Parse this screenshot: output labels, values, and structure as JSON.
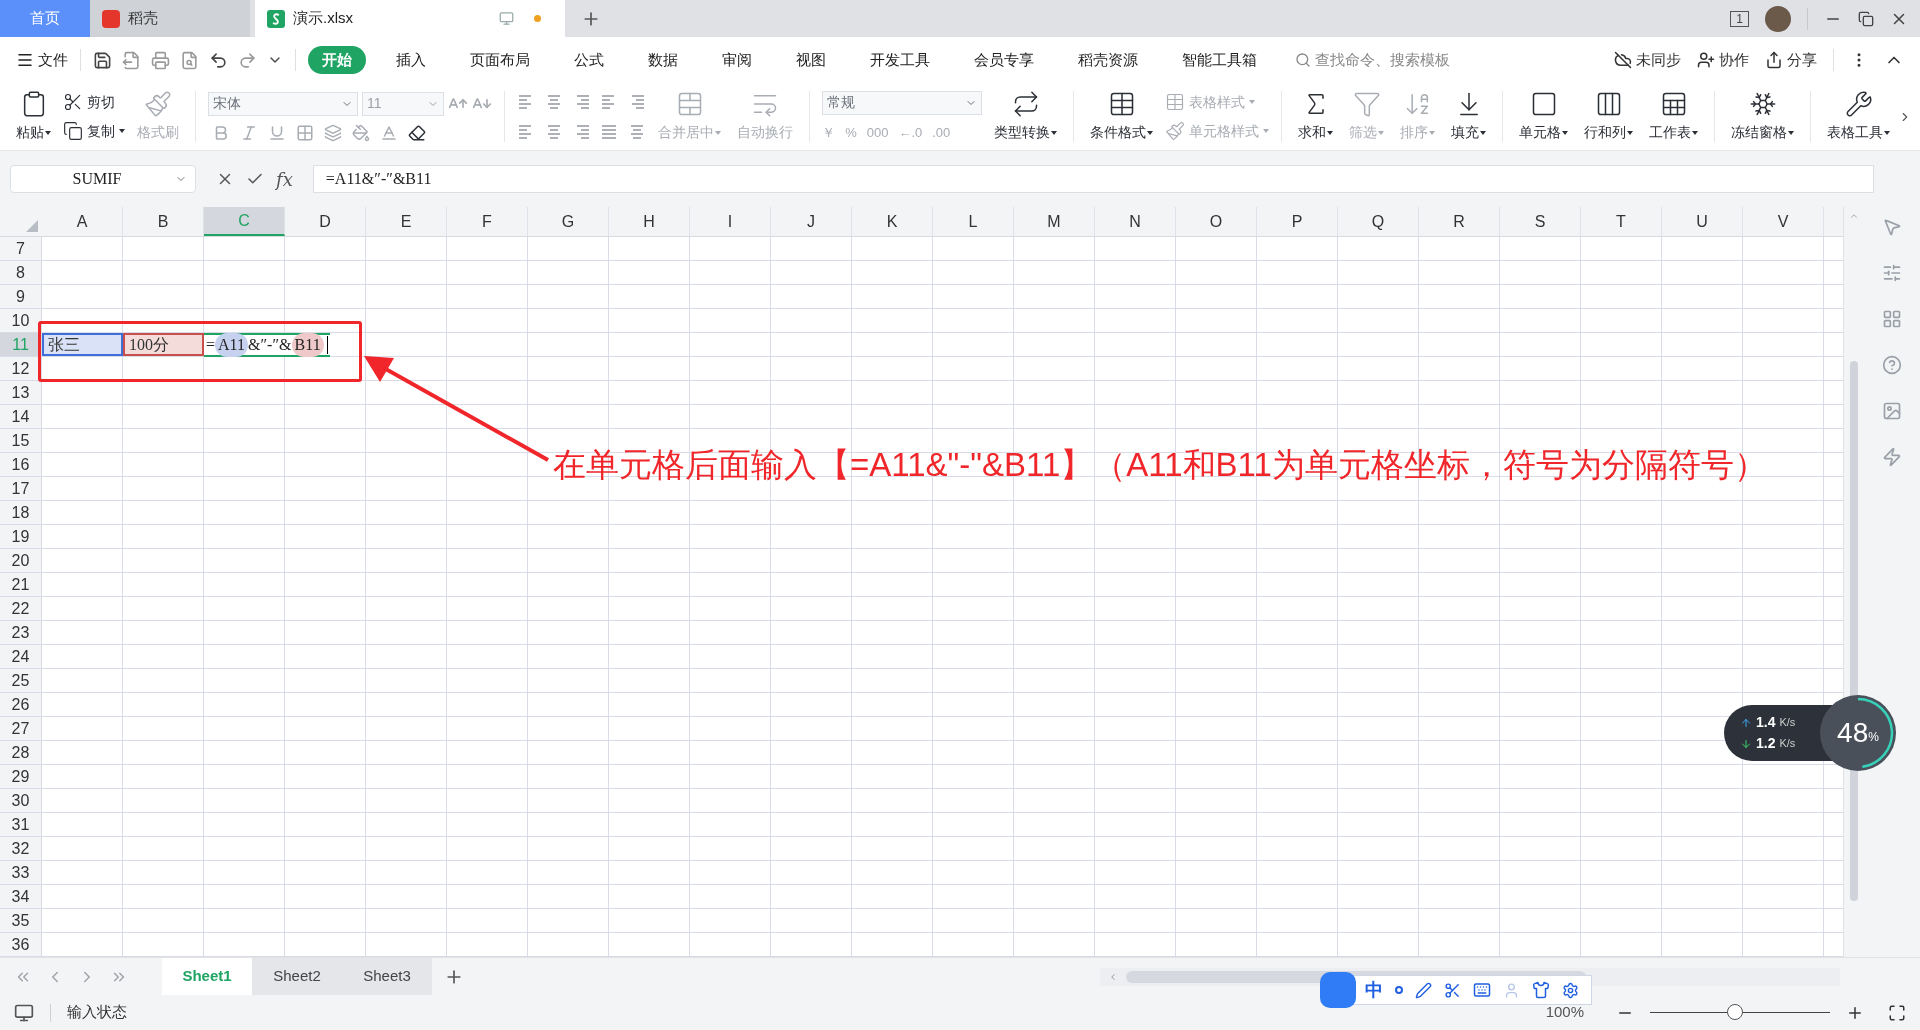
{
  "tabs": [
    {
      "label": "首页",
      "kind": "home",
      "selected": false
    },
    {
      "label": "稻壳",
      "kind": "docer",
      "selected": false
    },
    {
      "label": "演示.xlsx",
      "kind": "sheet",
      "selected": true
    }
  ],
  "window_count": "1",
  "menu": {
    "file": "文件",
    "items": [
      {
        "label": "开始",
        "selected": true
      },
      {
        "label": "插入",
        "selected": false
      },
      {
        "label": "页面布局",
        "selected": false
      },
      {
        "label": "公式",
        "selected": false
      },
      {
        "label": "数据",
        "selected": false
      },
      {
        "label": "审阅",
        "selected": false
      },
      {
        "label": "视图",
        "selected": false
      },
      {
        "label": "开发工具",
        "selected": false
      },
      {
        "label": "会员专享",
        "selected": false
      },
      {
        "label": "稻壳资源",
        "selected": false
      },
      {
        "label": "智能工具箱",
        "selected": false
      }
    ],
    "search": {
      "placeholder": "查找命令、搜索模板"
    },
    "actions": [
      "未同步",
      "协作",
      "分享"
    ]
  },
  "ribbon": [
    {
      "kind": "big",
      "label": "粘贴",
      "caret": true,
      "disabled": false
    },
    {
      "kind": "stack",
      "items": [
        {
          "label": "剪切",
          "caret": false,
          "disabled": false
        },
        {
          "label": "复制",
          "caret": true,
          "disabled": false
        }
      ]
    },
    {
      "kind": "big",
      "label": "格式刷",
      "caret": false,
      "disabled": true
    },
    {
      "kind": "sep"
    },
    {
      "kind": "font",
      "font": "宋体",
      "size": "11"
    },
    {
      "kind": "sep"
    },
    {
      "kind": "align"
    },
    {
      "kind": "big",
      "label": "合并居中",
      "caret": true,
      "disabled": true
    },
    {
      "kind": "big",
      "label": "自动换行",
      "caret": false,
      "disabled": true
    },
    {
      "kind": "sep"
    },
    {
      "kind": "number",
      "format": "常规",
      "buttons": [
        "￥",
        "%",
        "000",
        "←.0",
        ".00"
      ]
    },
    {
      "kind": "big",
      "label": "类型转换",
      "caret": true,
      "disabled": false
    },
    {
      "kind": "sep"
    },
    {
      "kind": "big",
      "label": "条件格式",
      "caret": true,
      "disabled": false
    },
    {
      "kind": "stack",
      "items": [
        {
          "label": "表格样式",
          "caret": true,
          "disabled": true
        },
        {
          "label": "单元格样式",
          "caret": true,
          "disabled": true
        }
      ]
    },
    {
      "kind": "sep"
    },
    {
      "kind": "big",
      "label": "求和",
      "caret": true,
      "disabled": false
    },
    {
      "kind": "big",
      "label": "筛选",
      "caret": true,
      "disabled": true
    },
    {
      "kind": "big",
      "label": "排序",
      "caret": true,
      "disabled": true
    },
    {
      "kind": "big",
      "label": "填充",
      "caret": true,
      "disabled": false
    },
    {
      "kind": "sep"
    },
    {
      "kind": "big",
      "label": "单元格",
      "caret": true,
      "disabled": false
    },
    {
      "kind": "big",
      "label": "行和列",
      "caret": true,
      "disabled": false
    },
    {
      "kind": "big",
      "label": "工作表",
      "caret": true,
      "disabled": false
    },
    {
      "kind": "sep"
    },
    {
      "kind": "big",
      "label": "冻结窗格",
      "caret": true,
      "disabled": false
    },
    {
      "kind": "sep"
    },
    {
      "kind": "big",
      "label": "表格工具",
      "caret": true,
      "disabled": false
    }
  ],
  "name_box": "SUMIF",
  "function_label": "fx",
  "formula": "=A11&″-″&B11",
  "columns": [
    {
      "label": "A",
      "selected": false
    },
    {
      "label": "B",
      "selected": false
    },
    {
      "label": "C",
      "selected": true
    },
    {
      "label": "D",
      "selected": false
    },
    {
      "label": "E",
      "selected": false
    },
    {
      "label": "F",
      "selected": false
    },
    {
      "label": "G",
      "selected": false
    },
    {
      "label": "H",
      "selected": false
    },
    {
      "label": "I",
      "selected": false
    },
    {
      "label": "J",
      "selected": false
    },
    {
      "label": "K",
      "selected": false
    },
    {
      "label": "L",
      "selected": false
    },
    {
      "label": "M",
      "selected": false
    },
    {
      "label": "N",
      "selected": false
    },
    {
      "label": "O",
      "selected": false
    },
    {
      "label": "P",
      "selected": false
    },
    {
      "label": "Q",
      "selected": false
    },
    {
      "label": "R",
      "selected": false
    },
    {
      "label": "S",
      "selected": false
    },
    {
      "label": "T",
      "selected": false
    },
    {
      "label": "U",
      "selected": false
    },
    {
      "label": "V",
      "selected": false
    }
  ],
  "rows": [
    {
      "label": "7",
      "selected": false
    },
    {
      "label": "8",
      "selected": false
    },
    {
      "label": "9",
      "selected": false
    },
    {
      "label": "10",
      "selected": false
    },
    {
      "label": "11",
      "selected": true,
      "cells": [
        {
          "kind": "ref",
          "text": "张三",
          "color": "#3f6fd8"
        },
        {
          "kind": "ref",
          "text": "100分",
          "color": "#c8504a"
        },
        {
          "kind": "editing",
          "parts": [
            {
              "kind": "plain",
              "text": "="
            },
            {
              "kind": "ref",
              "text": "A11",
              "color": "#c6d1ef"
            },
            {
              "kind": "plain",
              "text": "&″-″&"
            },
            {
              "kind": "ref",
              "text": "B11",
              "color": "#efc9c9"
            }
          ]
        }
      ]
    },
    {
      "label": "12",
      "selected": false
    },
    {
      "label": "13",
      "selected": false
    },
    {
      "label": "14",
      "selected": false
    },
    {
      "label": "15",
      "selected": false
    },
    {
      "label": "16",
      "selected": false
    },
    {
      "label": "17",
      "selected": false
    },
    {
      "label": "18",
      "selected": false
    },
    {
      "label": "19",
      "selected": false
    },
    {
      "label": "20",
      "selected": false
    },
    {
      "label": "21",
      "selected": false
    },
    {
      "label": "22",
      "selected": false
    },
    {
      "label": "23",
      "selected": false
    },
    {
      "label": "24",
      "selected": false
    },
    {
      "label": "25",
      "selected": false
    },
    {
      "label": "26",
      "selected": false
    },
    {
      "label": "27",
      "selected": false
    },
    {
      "label": "28",
      "selected": false
    },
    {
      "label": "29",
      "selected": false
    },
    {
      "label": "30",
      "selected": false
    },
    {
      "label": "31",
      "selected": false
    },
    {
      "label": "32",
      "selected": false
    },
    {
      "label": "33",
      "selected": false
    },
    {
      "label": "34",
      "selected": false
    },
    {
      "label": "35",
      "selected": false
    },
    {
      "label": "36",
      "selected": false
    }
  ],
  "annotation": {
    "text": "在单元格后面输入【=A11&\"-\"&B11】（A11和B11为单元格坐标，符号为分隔符号）"
  },
  "sheets": [
    {
      "label": "Sheet1",
      "selected": true
    },
    {
      "label": "Sheet2",
      "selected": false
    },
    {
      "label": "Sheet3",
      "selected": false
    }
  ],
  "speed": {
    "up": "1.4",
    "up_unit": "K/s",
    "down": "1.2",
    "down_unit": "K/s",
    "percent": "48",
    "percent_unit": "%",
    "level": 0.48
  },
  "ime": {
    "mode": "中"
  },
  "status": {
    "mode": "输入状态",
    "zoom": "100%",
    "zoom_slider": {
      "level": 0.47
    }
  }
}
